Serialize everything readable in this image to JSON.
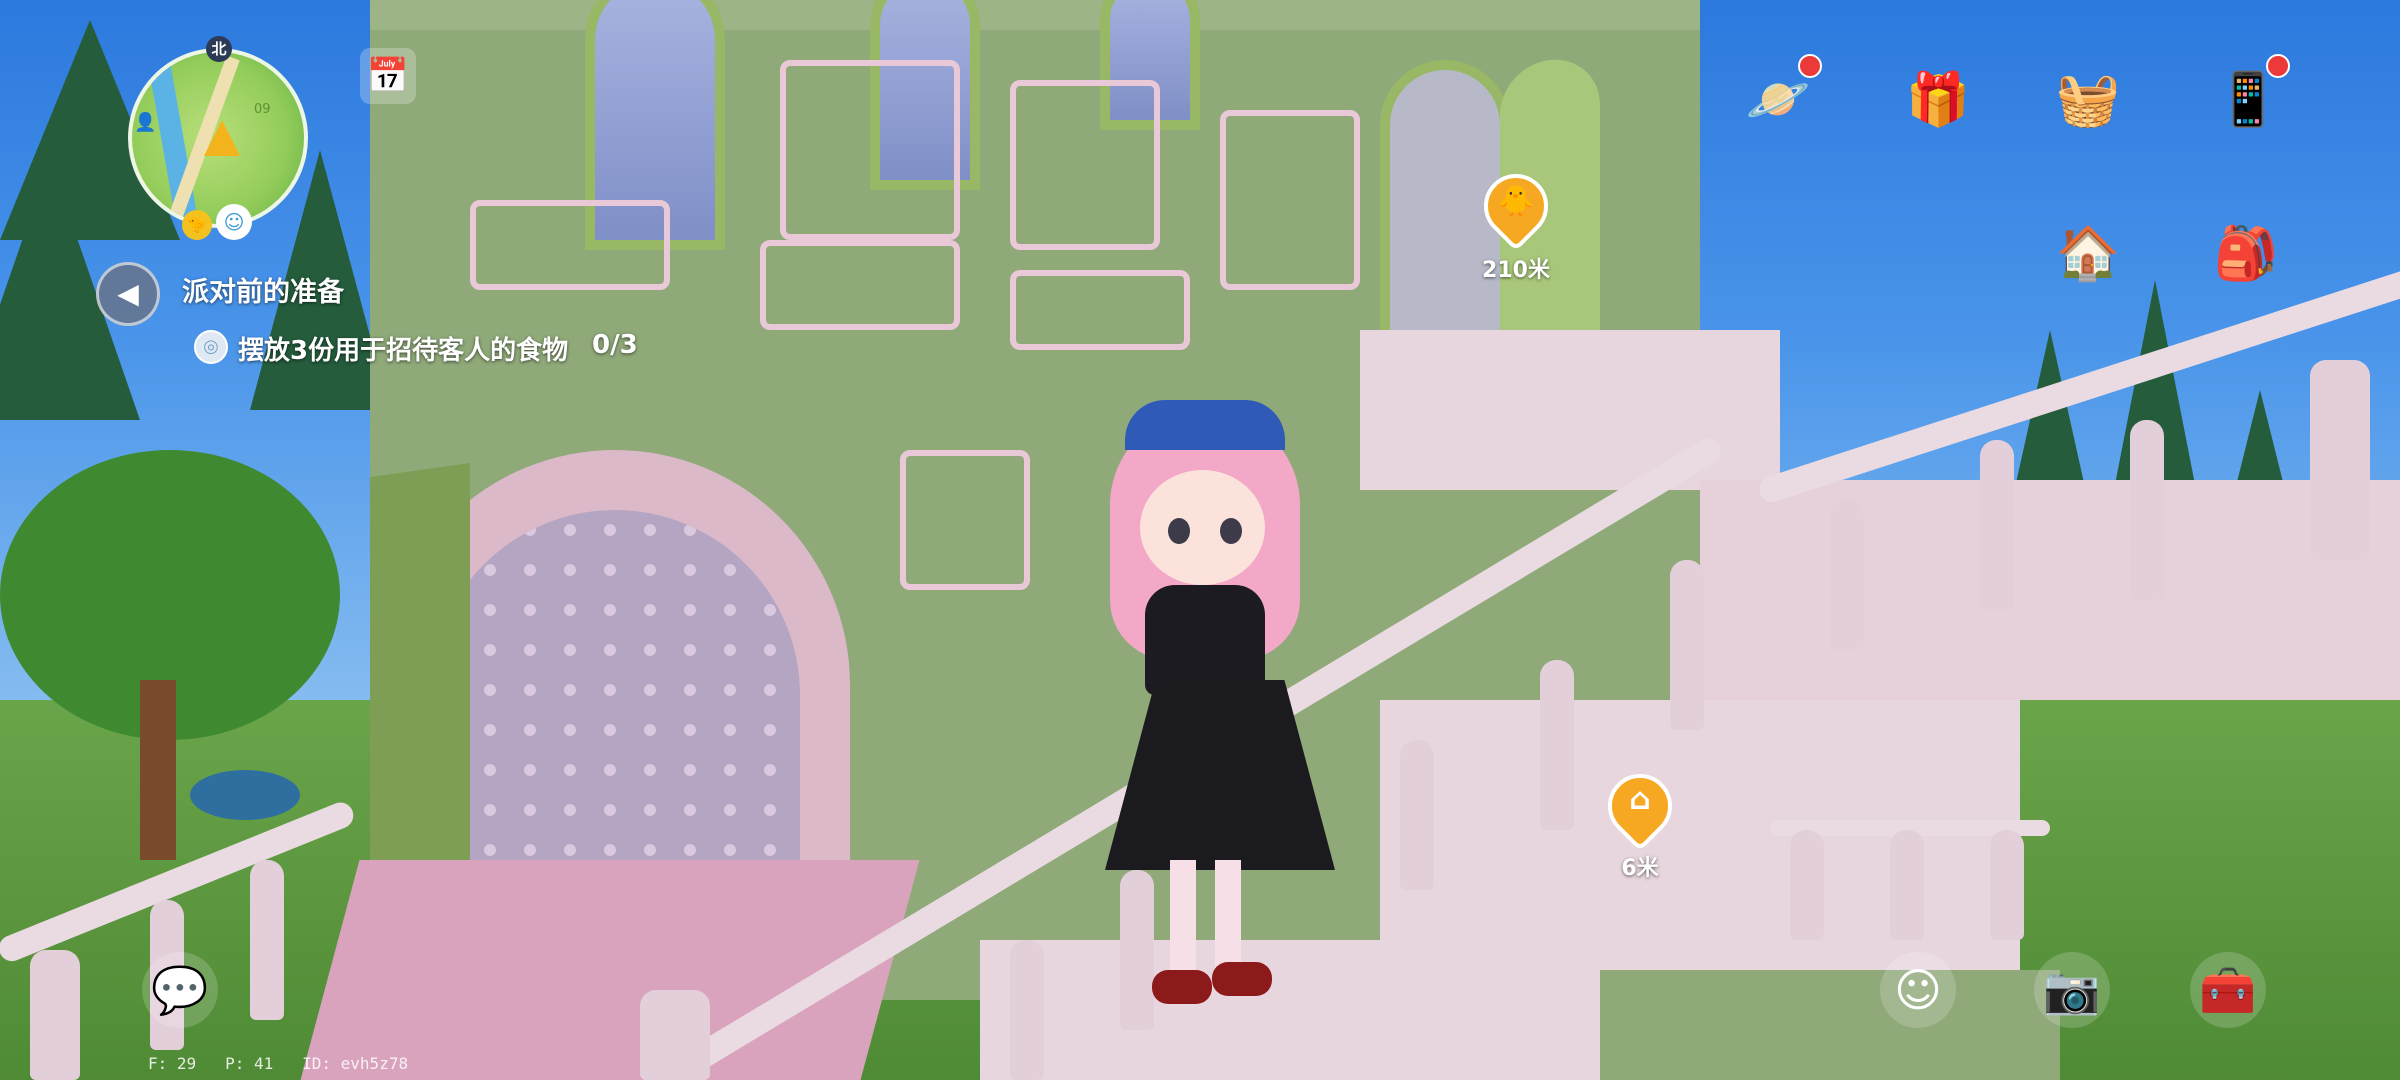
{
  "quest": {
    "title": "派对前的准备",
    "task": "摆放3份用于招待客人的食物",
    "progress": "0/3"
  },
  "minimap": {
    "north_label": "北",
    "map_number": "09"
  },
  "markers": {
    "door_distance": "210米",
    "home_distance": "6米"
  },
  "top_icons": [
    {
      "name": "planet-icon",
      "glyph": "🪐",
      "badge": true
    },
    {
      "name": "gift-house-icon",
      "glyph": "🎁",
      "badge": false
    },
    {
      "name": "basket-icon",
      "glyph": "🧺",
      "badge": false
    },
    {
      "name": "phone-icon",
      "glyph": "📱",
      "badge": true
    },
    {
      "name": "house-build-icon",
      "glyph": "🏠",
      "badge": false
    },
    {
      "name": "backpack-icon",
      "glyph": "🎒",
      "badge": false
    }
  ],
  "debug": {
    "text": "F: 29   P: 41   ID: evh5z78"
  },
  "colors": {
    "marker": "#f6a823",
    "sky": "#2c79de",
    "house_wall": "#8fa979"
  }
}
